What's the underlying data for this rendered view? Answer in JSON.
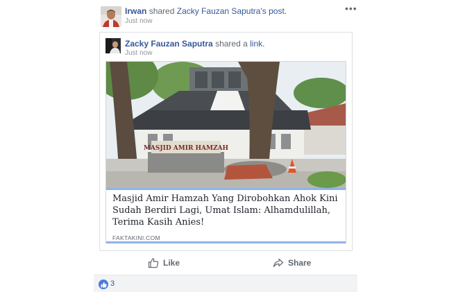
{
  "post": {
    "author": "Irwan",
    "action_text": "shared",
    "original_author_possessive": "Zacky Fauzan Saputra",
    "possessive_suffix": "'s",
    "object_text": "post.",
    "timestamp": "Just now"
  },
  "shared": {
    "author": "Zacky Fauzan Saputra",
    "action_text": "shared a",
    "object_text": "link.",
    "timestamp": "Just now"
  },
  "link_card": {
    "image_sign_text": "MASJID AMIR HAMZAH",
    "title": "Masjid Amir Hamzah Yang Dirobohkan Ahok Kini Sudah Berdiri Lagi, Umat Islam: Alhamdulillah, Terima Kasih Anies!",
    "domain": "FAKTAKINI.COM"
  },
  "actions": {
    "like_label": "Like",
    "share_label": "Share"
  },
  "reactions": {
    "count": "3",
    "icon": "like-reaction-icon"
  },
  "colors": {
    "link_blue": "#365899",
    "muted": "#616770",
    "card_accent": "#8fb3e3",
    "footer_bg": "#f2f3f5"
  },
  "icons": {
    "more": "more-options-icon",
    "like": "thumbs-up-icon",
    "share": "share-arrow-icon"
  }
}
